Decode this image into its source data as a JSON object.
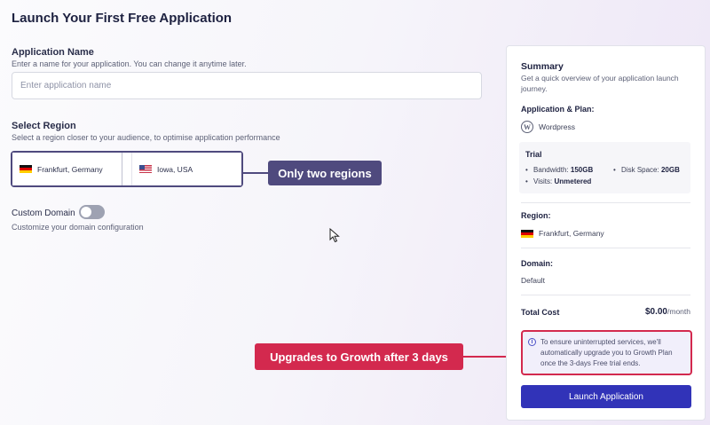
{
  "page": {
    "title": "Launch Your First Free Application"
  },
  "application_name": {
    "label": "Application Name",
    "help": "Enter a name for your application. You can change it anytime later.",
    "placeholder": "Enter application name",
    "value": ""
  },
  "region": {
    "label": "Select Region",
    "help": "Select a region closer to your audience, to optimise application performance",
    "options": [
      {
        "label": "Frankfurt, Germany",
        "flag": "germany-flag-icon",
        "selected": true
      },
      {
        "label": "Iowa, USA",
        "flag": "usa-flag-icon",
        "selected": false
      }
    ]
  },
  "custom_domain": {
    "label": "Custom Domain",
    "enabled": false,
    "help": "Customize your domain configuration"
  },
  "annotations": {
    "regions_callout": "Only two regions",
    "upgrade_callout": "Upgrades to Growth after 3 days",
    "regions_color": "#4f4a7e",
    "upgrade_color": "#d3294e"
  },
  "summary": {
    "title": "Summary",
    "description": "Get a quick overview of your application launch journey.",
    "app_plan_heading": "Application & Plan:",
    "app_name": "Wordpress",
    "app_icon": "wordpress-icon",
    "trial": {
      "heading": "Trial",
      "bandwidth_label": "Bandwidth:",
      "bandwidth_value": "150GB",
      "disk_label": "Disk Space:",
      "disk_value": "20GB",
      "visits_label": "Visits:",
      "visits_value": "Unmetered"
    },
    "region_heading": "Region:",
    "region_value": "Frankfurt, Germany",
    "domain_heading": "Domain:",
    "domain_value": "Default",
    "total_cost_label": "Total Cost",
    "total_cost_amount": "$0.00",
    "total_cost_period": "/month",
    "notice": "To ensure uninterrupted services, we'll automatically upgrade you to Growth Plan once the 3-days Free trial ends.",
    "launch_button": "Launch Application",
    "accent_color": "#3133b8"
  }
}
